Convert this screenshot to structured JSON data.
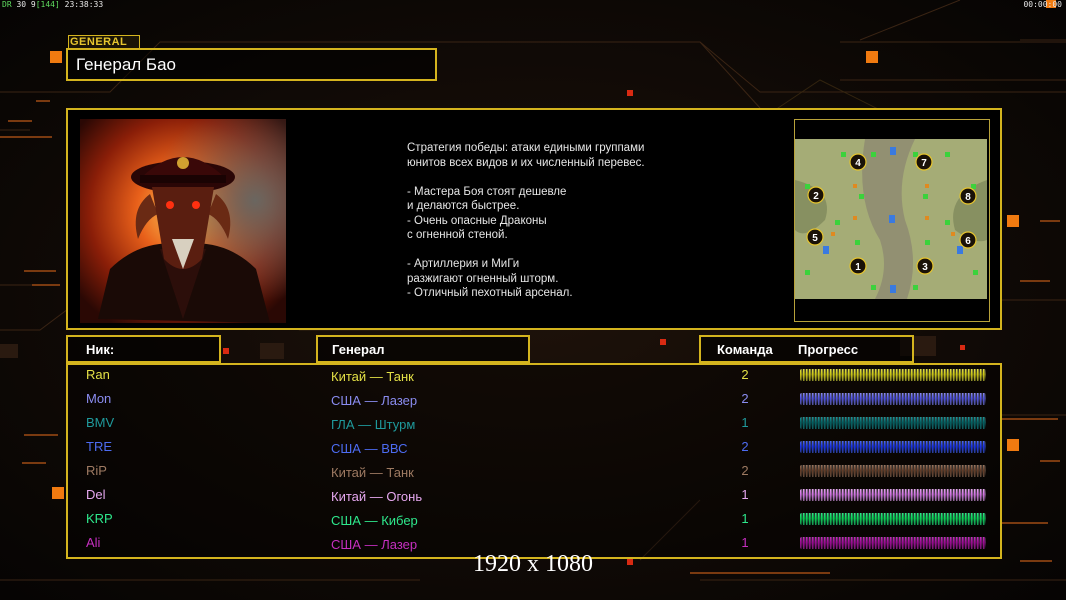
{
  "overlay": {
    "fps_prefix": "DR",
    "fps_text": "30 9",
    "fps_extra": "[144]",
    "clock": "23:38:33",
    "timer": "00:00:00"
  },
  "header": {
    "tag": "GENERAL",
    "general_name": "Генерал Бао"
  },
  "description": [
    "Стратегия победы: атаки едиными группами",
    "юнитов всех видов и их численный перевес.",
    "",
    "- Мастера Боя стоят дешевле",
    "и делаются быстрее.",
    "- Очень опасные Драконы",
    "с огненной стеной.",
    "",
    "- Артиллерия и МиГи",
    "разжигают огненный шторм.",
    "- Отличный пехотный арсенал."
  ],
  "map": {
    "spawns": [
      "1",
      "2",
      "3",
      "4",
      "5",
      "6",
      "7",
      "8"
    ]
  },
  "table": {
    "col_nick": "Ник:",
    "col_general": "Генерал",
    "col_team": "Команда",
    "col_progress": "Прогресс"
  },
  "players": [
    {
      "nick": "Ran",
      "general": "Китай — Танк",
      "team": "2",
      "color": "#e3e046",
      "progress": 1.0
    },
    {
      "nick": "Mon",
      "general": "США — Лазер",
      "team": "2",
      "color": "#8a8cf0",
      "progress": 1.0
    },
    {
      "nick": "BMV",
      "general": "ГЛА — Штурм",
      "team": "1",
      "color": "#1f9a9c",
      "progress": 1.0
    },
    {
      "nick": "TRE",
      "general": "США — ВВС",
      "team": "2",
      "color": "#4d6cf2",
      "progress": 1.0
    },
    {
      "nick": "RiP",
      "general": "Китай — Танк",
      "team": "2",
      "color": "#9e7a62",
      "progress": 1.0
    },
    {
      "nick": "Del",
      "general": "Китай — Огонь",
      "team": "1",
      "color": "#e6a8f0",
      "progress": 1.0
    },
    {
      "nick": "KRP",
      "general": "США — Кибер",
      "team": "1",
      "color": "#2ee88c",
      "progress": 1.0
    },
    {
      "nick": "Ali",
      "general": "США — Лазер",
      "team": "1",
      "color": "#c62fc0",
      "progress": 1.0
    }
  ],
  "watermark": "1920 x 1080",
  "colors": {
    "frame": "#d4b41e",
    "accent_orange": "#f07a10"
  }
}
